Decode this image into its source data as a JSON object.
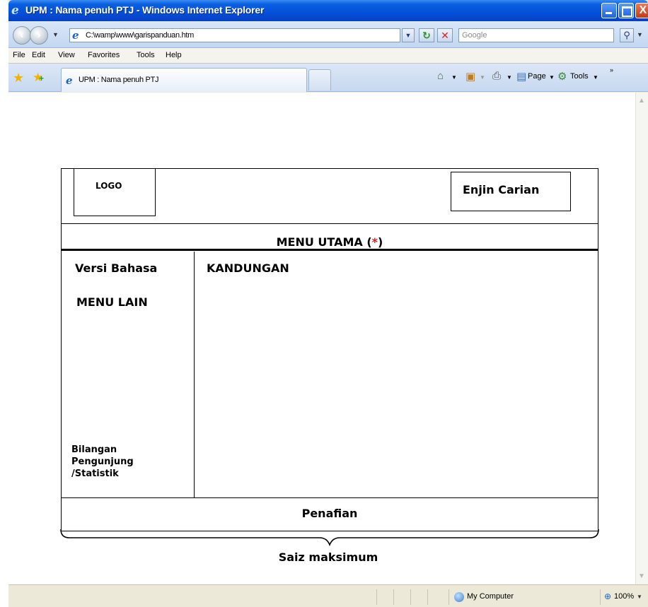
{
  "window": {
    "title": "UPM : Nama penuh PTJ - Windows Internet Explorer",
    "close_glyph": "X"
  },
  "address_bar": {
    "url": "C:\\wamp\\www\\garispanduan.htm",
    "search_placeholder": "Google"
  },
  "menu": {
    "items": [
      "File",
      "Edit",
      "View",
      "Favorites",
      "Tools",
      "Help"
    ]
  },
  "tab": {
    "label": "UPM : Nama penuh PTJ"
  },
  "command_bar": {
    "page_label": "Page",
    "tools_label": "Tools"
  },
  "page": {
    "logo": "LOGO",
    "search_engine": "Enjin Carian",
    "main_menu": "MENU UTAMA (",
    "main_menu_asterisk": "*",
    "main_menu_close": ")",
    "language": "Versi Bahasa",
    "other_menu": "MENU LAIN",
    "visitor_stats_line1": "Bilangan",
    "visitor_stats_line2": "Pengunjung",
    "visitor_stats_line3": "/Statistik",
    "content": "KANDUNGAN",
    "disclaimer": "Penafian",
    "max_size": "Saiz maksimum"
  },
  "status_bar": {
    "zone": "My Computer",
    "zoom": "100%"
  },
  "colors": {
    "asterisk": "#d21f1f",
    "titlebar": "#0450d8"
  }
}
